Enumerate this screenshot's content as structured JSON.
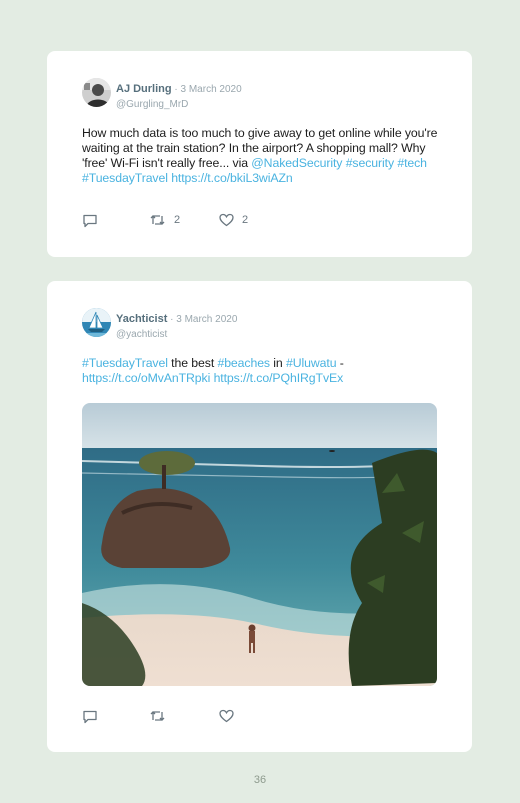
{
  "tweets": [
    {
      "name": "AJ Durling",
      "sep": " · ",
      "date": "3 March 2020",
      "handle": "@Gurgling_MrD",
      "text": [
        {
          "t": "How much data is too much to give away to get online while you're waiting at the train station? In the airport? A shopping mall? Why 'free' Wi-Fi isn't really free... via "
        },
        {
          "link": "@NakedSecurity"
        },
        {
          "t": " "
        },
        {
          "link": "#security"
        },
        {
          "t": " "
        },
        {
          "link": "#tech"
        },
        {
          "t": " "
        },
        {
          "link": "#TuesdayTravel"
        },
        {
          "t": " "
        },
        {
          "link": "https://t.co/bkiL3wiAZn"
        }
      ],
      "retweets": "2",
      "likes": "2",
      "avatar_icon": "person-avatar-icon"
    },
    {
      "name": "Yachticist",
      "sep": " · ",
      "date": "3 March 2020",
      "handle": "@yachticist",
      "text": [
        {
          "link": "#TuesdayTravel"
        },
        {
          "t": " the best "
        },
        {
          "link": "#beaches"
        },
        {
          "t": " in "
        },
        {
          "link": "#Uluwatu"
        },
        {
          "t": " - "
        },
        {
          "link": "https://t.co/oMvAnTRpki"
        },
        {
          "t": " "
        },
        {
          "link": "https://t.co/PQhIRgTvEx"
        }
      ],
      "retweets": "",
      "likes": "",
      "avatar_icon": "sailboat-logo-icon",
      "photo": "beach-photo-rock-island"
    }
  ],
  "icons": [
    "reply-icon",
    "retweet-icon",
    "like-icon"
  ],
  "colors": {
    "background": "#e3ece3",
    "card": "#ffffff",
    "link": "#4ab3e0",
    "name": "#566f7c"
  },
  "page_number": "36"
}
